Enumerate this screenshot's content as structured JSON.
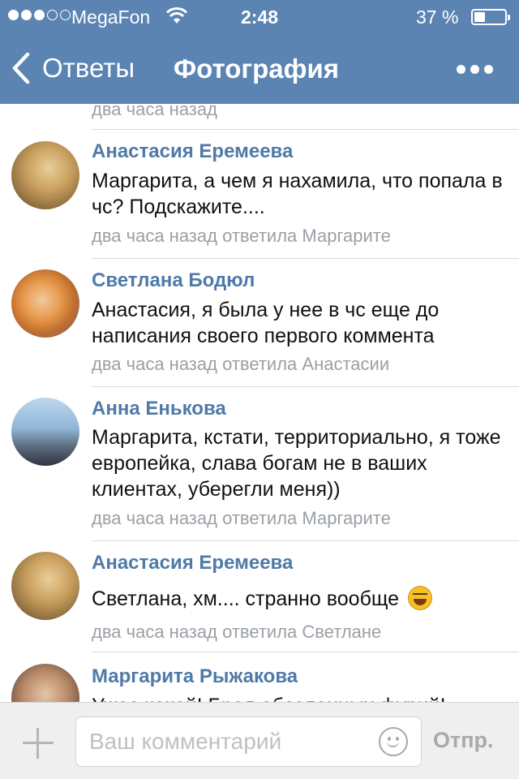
{
  "status_bar": {
    "carrier": "MegaFon",
    "time": "2:48",
    "battery_percent": "37 %",
    "signal_bars_filled": 3,
    "signal_bars_total": 5
  },
  "nav": {
    "back_label": "Ответы",
    "title": "Фотография"
  },
  "previous_comment": {
    "meta": "два часа назад"
  },
  "comments": [
    {
      "author": "Анастасия Еремеева",
      "text": "Маргарита, а чем я нахамила, что попала в чс? Подскажите....",
      "meta": "два часа назад ответила Маргарите"
    },
    {
      "author": "Светлана Бодюл",
      "text": "Анастасия, я была у нее в чс еще до написания своего первого коммента",
      "meta": "два часа назад ответила Анастасии"
    },
    {
      "author": "Анна Енькова",
      "text": "Маргарита, кстати, территориально, я тоже европейка, слава богам не в ваших клиентах, уберегли меня))",
      "meta": "два часа назад ответила Маргарите"
    },
    {
      "author": "Анастасия Еремеева",
      "text": "Светлана, хм.... странно вообще",
      "emoji": "laughing-emoji",
      "meta": "два часа назад ответила Светлане"
    },
    {
      "author": "Маргарита Рыжакова",
      "text": "Ужас какой! Бред обозленных фурий!"
    }
  ],
  "composer": {
    "placeholder": "Ваш комментарий",
    "send_label": "Отпр."
  },
  "colors": {
    "nav_background": "#5b84b3",
    "author_link": "#4f7aa8",
    "meta_text": "#9aa0a6"
  }
}
